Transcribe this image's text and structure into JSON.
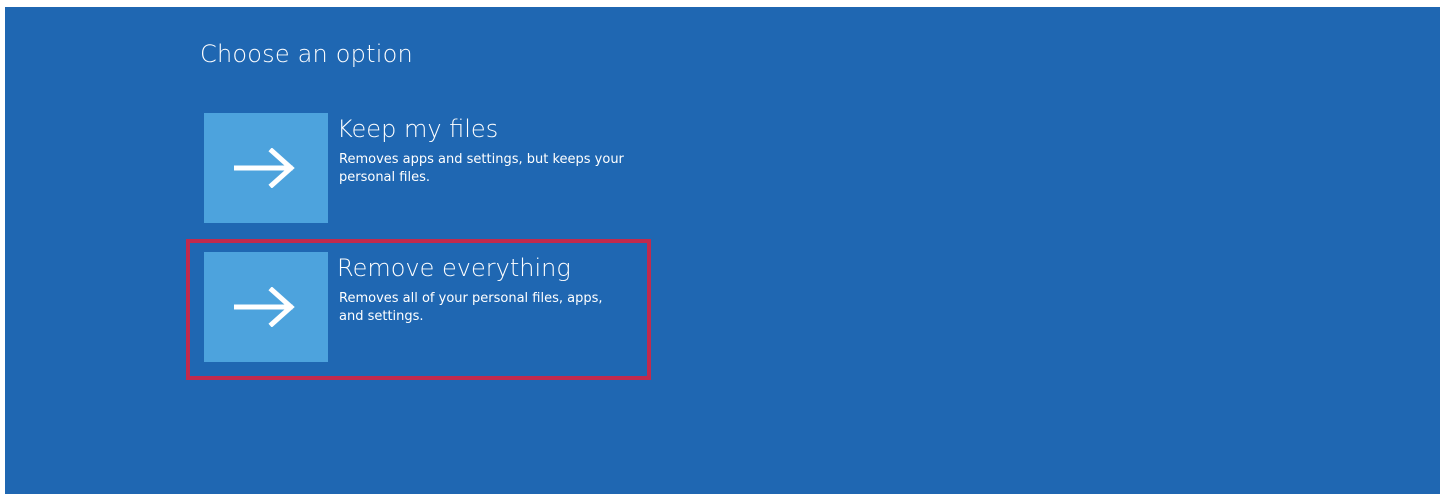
{
  "page": {
    "title": "Choose an option"
  },
  "options": [
    {
      "heading": "Keep my files",
      "description": "Removes apps and settings, but keeps your personal files.",
      "icon": "arrow-right-icon"
    },
    {
      "heading": "Remove everything",
      "description": "Removes all of your personal files, apps, and settings.",
      "icon": "arrow-right-icon"
    }
  ],
  "colors": {
    "background": "#1f67b2",
    "tile": "#4da3dd",
    "text": "#ffffff",
    "highlight": "#c12a4d"
  }
}
